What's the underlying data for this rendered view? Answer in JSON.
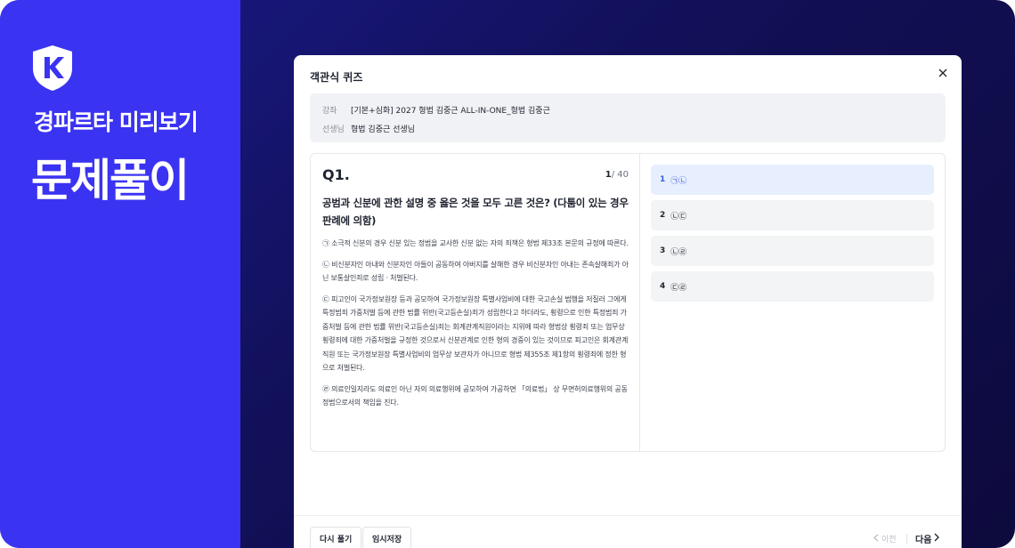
{
  "brand": {
    "subtitle": "경파르타 미리보기",
    "title": "문제풀이"
  },
  "modal": {
    "title": "객관식 퀴즈",
    "close_icon": "close-icon"
  },
  "info": {
    "course_label": "강좌",
    "course_value": "[기본+심화] 2027 형법 김중근 ALL-IN-ONE_형법 김중근",
    "teacher_label": "선생님",
    "teacher_value": "형법 김중근 선생님"
  },
  "question": {
    "number": "Q1.",
    "current": "1",
    "total": "/ 40",
    "title": "공범과 신분에 관한 설명 중 옳은 것을 모두 고른 것은? (다툼이 있는 경우 판례에 의함)",
    "statements": [
      "㉠ 소극적 신분의 경우 신분 있는 정범을 교사한 신분 없는 자의 죄책은 형법 제33조 본문의 규정에 따른다.",
      "㉡ 비신분자인 아내와 신분자인 아들이 공동하여 아버지를 살해한 경우 비신분자인 아내는 존속살해죄가 아닌 보통살인죄로 성립 · 처벌된다.",
      "㉢ 피고인이 국가정보원장 등과 공모하여 국가정보원장 특별사업비에 대한 국고손실 범행을 저질러 그에게 특정범죄 가중처벌 등에 관한 법률 위반(국고등손실)죄가 성립한다고 하더라도, 횡령으로 인한 특정범죄 가중처벌 등에 관한 법률 위반(국고등손실)죄는 회계관계직원이라는 지위에 따라 형법상 횡령죄 또는 업무상횡령죄에 대한 가중처벌을 규정한 것으로서 신분관계로 인한 형의 경중이 있는 것이므로 피고인은 회계관계직원 또는 국가정보원장 특별사업비의 업무상 보관자가 아니므로 형법 제355조 제1항의 횡령죄에 정한 형으로 처벌된다.",
      "㉣ 의료인일지라도 의료인 아닌 자의 의료행위에 공모하여 가공하면 「의료법」 상 무면허의료행위의 공동정범으로서의 책임을 진다."
    ]
  },
  "options": [
    {
      "num": "1",
      "label": "㉠㉡",
      "selected": true
    },
    {
      "num": "2",
      "label": "㉡㉢",
      "selected": false
    },
    {
      "num": "3",
      "label": "㉡㉣",
      "selected": false
    },
    {
      "num": "4",
      "label": "㉢㉣",
      "selected": false
    }
  ],
  "footer": {
    "retry_label": "다시 풀기",
    "save_label": "임시저장",
    "prev_label": "이전",
    "next_label": "다음"
  },
  "colors": {
    "left_panel": "#3b33f2",
    "selected_option": "#e7efff",
    "selected_text": "#3a5bd9"
  }
}
